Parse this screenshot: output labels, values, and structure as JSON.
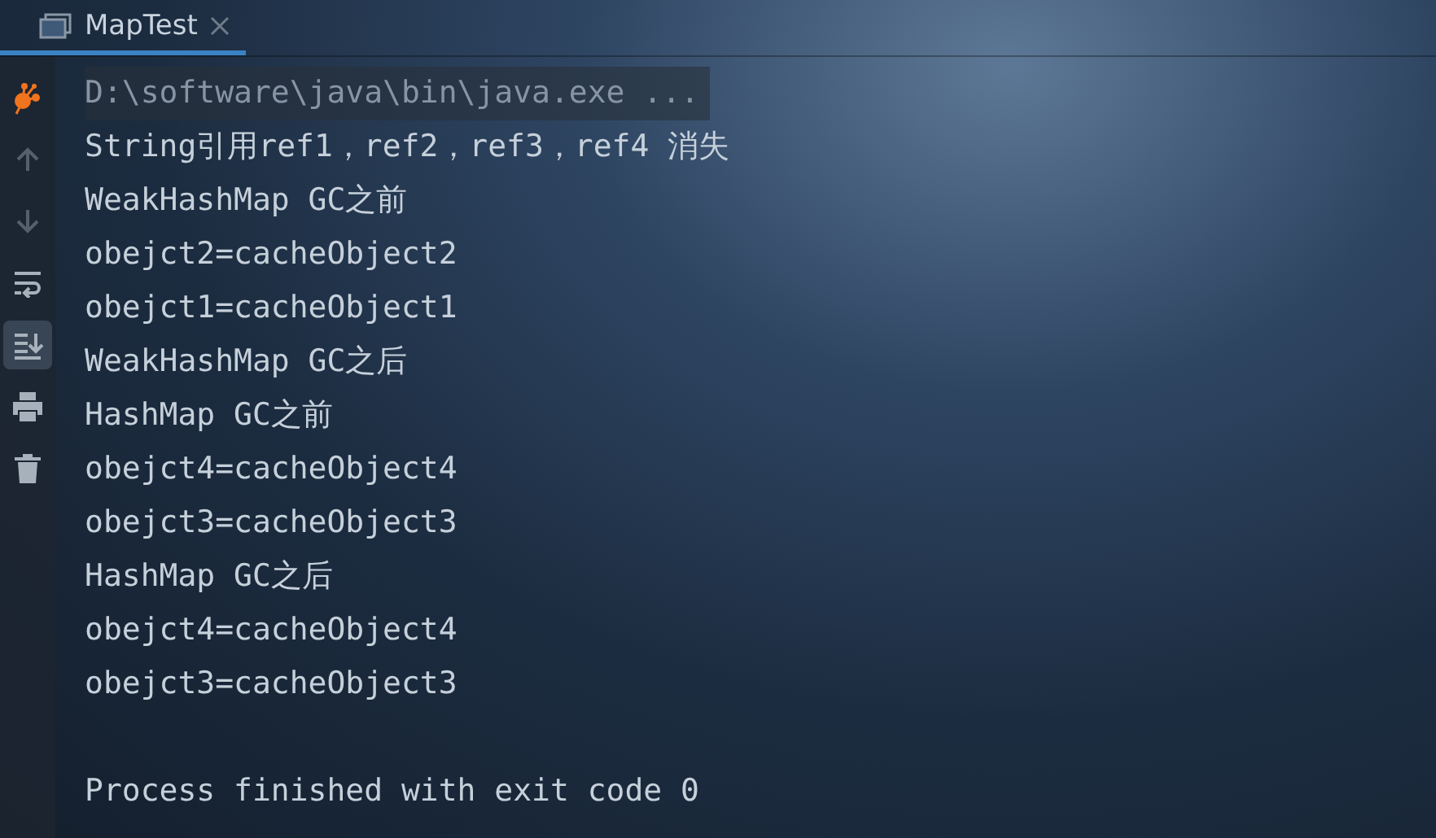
{
  "tabs": [
    {
      "label": "MapTest",
      "selected": true
    }
  ],
  "toolbar": [
    {
      "kind": "debug",
      "disabled": false,
      "selected": false
    },
    {
      "kind": "up",
      "disabled": true,
      "selected": false
    },
    {
      "kind": "down",
      "disabled": true,
      "selected": false
    },
    {
      "kind": "wrap",
      "disabled": false,
      "selected": false
    },
    {
      "kind": "scroll-end",
      "disabled": false,
      "selected": true
    },
    {
      "kind": "print",
      "disabled": false,
      "selected": false
    },
    {
      "kind": "trash",
      "disabled": false,
      "selected": false
    }
  ],
  "console": [
    {
      "kind": "command",
      "text": "D:\\software\\java\\bin\\java.exe ..."
    },
    {
      "kind": "output",
      "text": "String引用ref1，ref2，ref3，ref4 消失"
    },
    {
      "kind": "output",
      "text": "WeakHashMap GC之前"
    },
    {
      "kind": "output",
      "text": "obejct2=cacheObject2"
    },
    {
      "kind": "output",
      "text": "obejct1=cacheObject1"
    },
    {
      "kind": "output",
      "text": "WeakHashMap GC之后"
    },
    {
      "kind": "output",
      "text": "HashMap GC之前"
    },
    {
      "kind": "output",
      "text": "obejct4=cacheObject4"
    },
    {
      "kind": "output",
      "text": "obejct3=cacheObject3"
    },
    {
      "kind": "output",
      "text": "HashMap GC之后"
    },
    {
      "kind": "output",
      "text": "obejct4=cacheObject4"
    },
    {
      "kind": "output",
      "text": "obejct3=cacheObject3"
    },
    {
      "kind": "exit",
      "text": "Process finished with exit code 0"
    }
  ]
}
